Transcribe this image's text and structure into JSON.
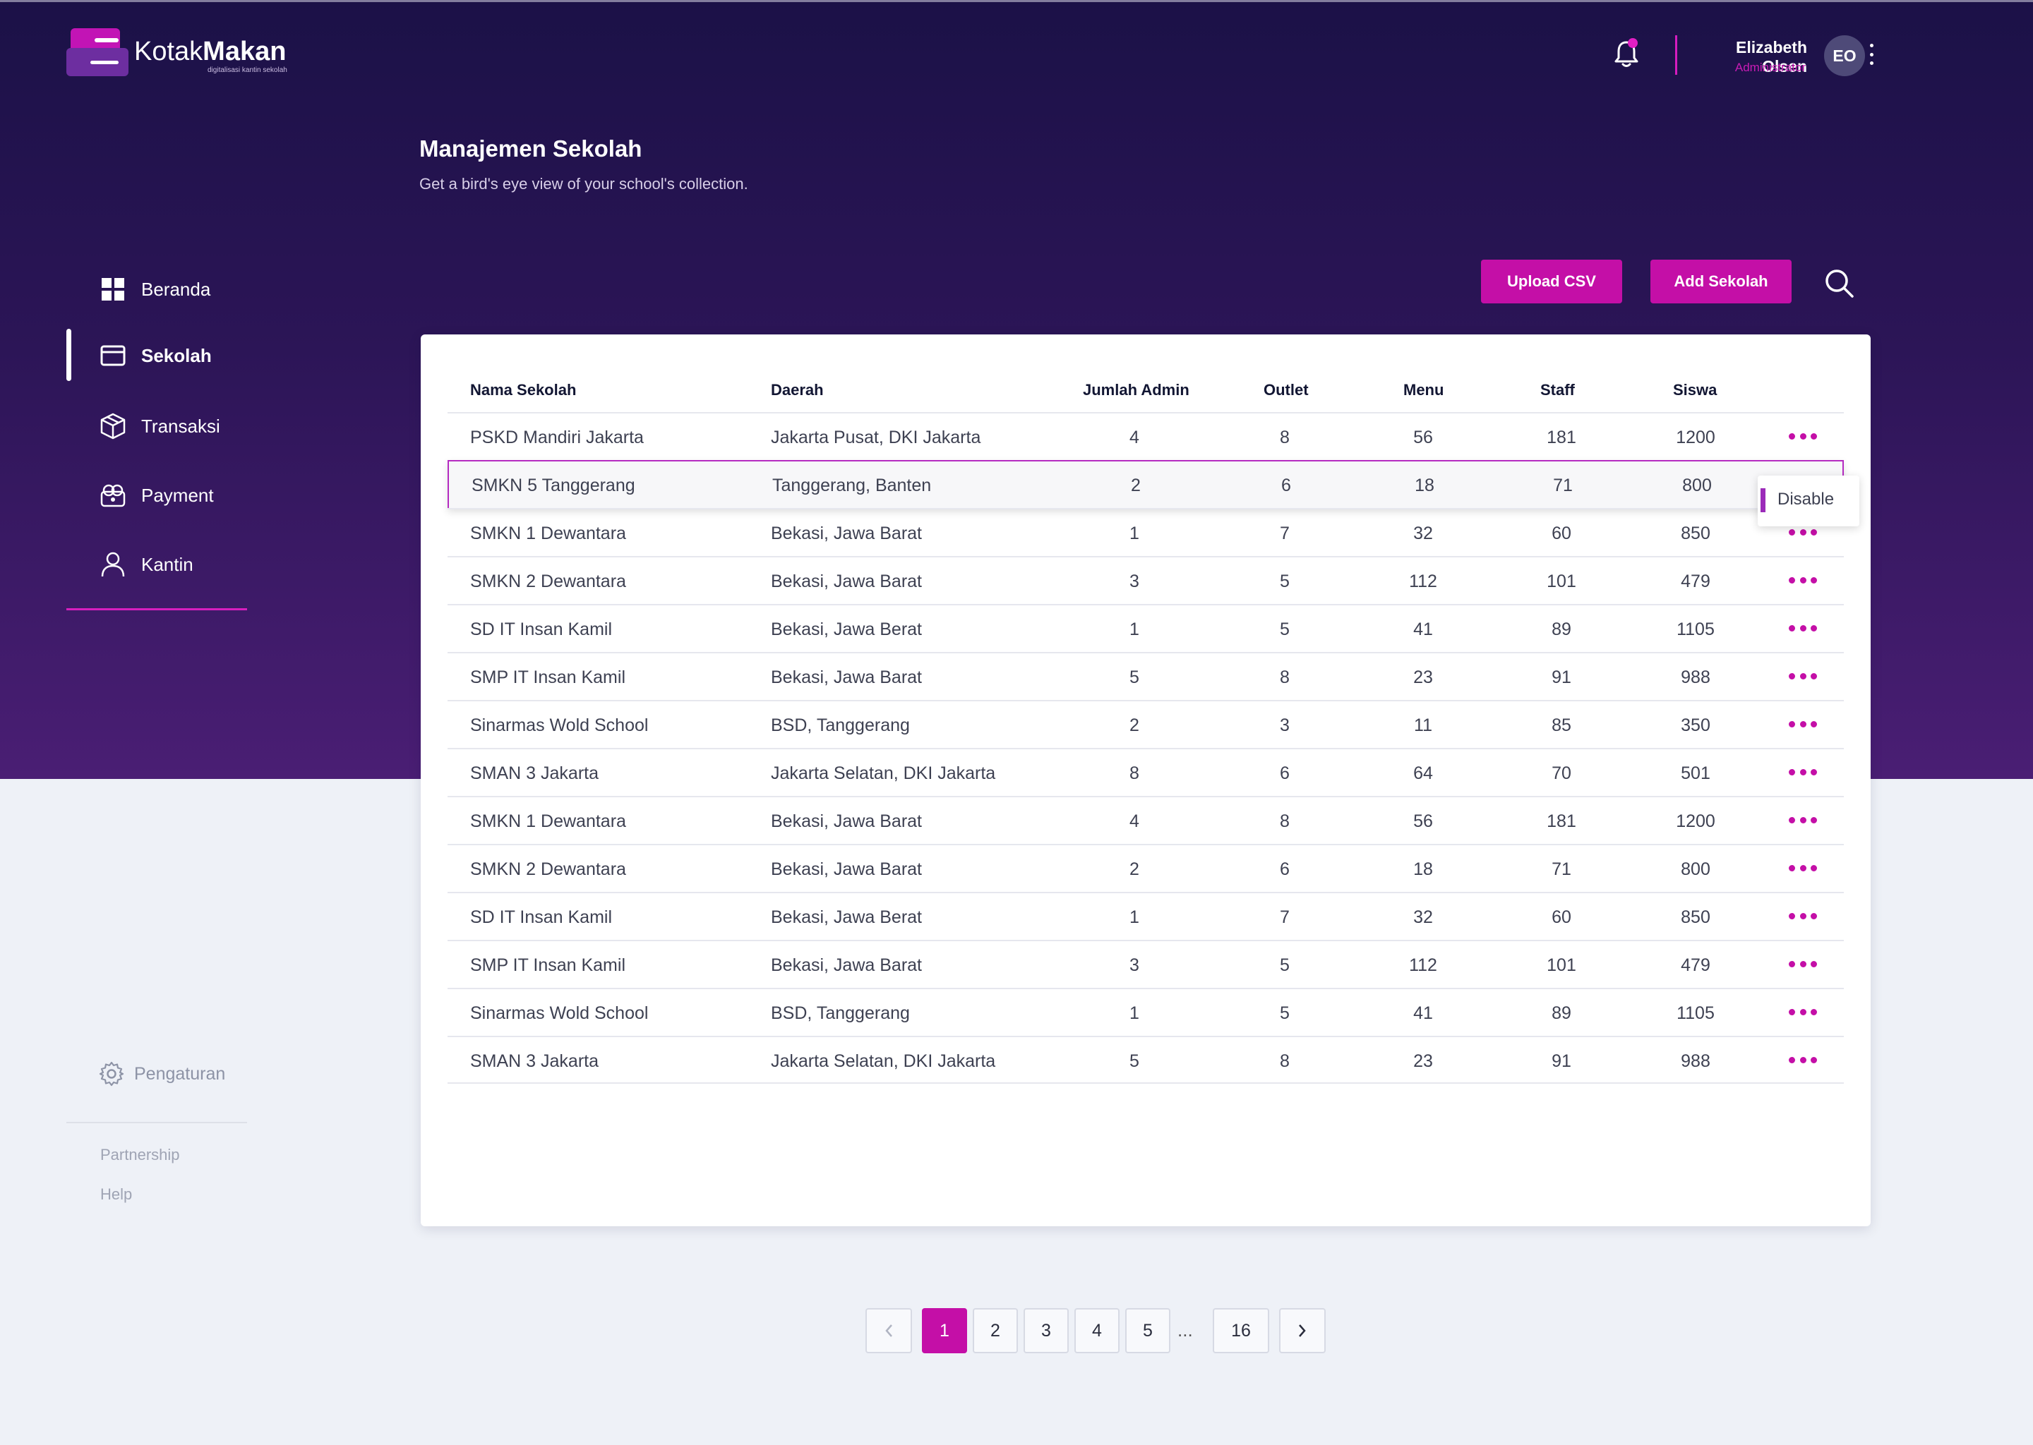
{
  "app": {
    "brand_light": "Kotak",
    "brand_bold": "Makan",
    "tagline": "digitalisasi kantin sekolah"
  },
  "header": {
    "user_name": "Elizabeth Olsen",
    "user_role": "Administrator",
    "avatar_initials": "EO"
  },
  "page": {
    "title": "Manajemen Sekolah",
    "subtitle": "Get a bird's eye view of your school's collection."
  },
  "sidebar": {
    "items": [
      {
        "label": "Beranda",
        "icon": "grid-icon",
        "active": false
      },
      {
        "label": "Sekolah",
        "icon": "card-icon",
        "active": true
      },
      {
        "label": "Transaksi",
        "icon": "box-icon",
        "active": false
      },
      {
        "label": "Payment",
        "icon": "wallet-icon",
        "active": false
      },
      {
        "label": "Kantin",
        "icon": "user-icon",
        "active": false
      }
    ],
    "settings_label": "Pengaturan",
    "links": [
      "Partnership",
      "Help"
    ]
  },
  "actions": {
    "upload_label": "Upload CSV",
    "add_label": "Add Sekolah"
  },
  "table": {
    "columns": [
      "Nama Sekolah",
      "Daerah",
      "Jumlah Admin",
      "Outlet",
      "Menu",
      "Staff",
      "Siswa"
    ],
    "rows": [
      [
        "PSKD Mandiri Jakarta",
        "Jakarta Pusat, DKI Jakarta",
        "4",
        "8",
        "56",
        "181",
        "1200"
      ],
      [
        "SMKN 5 Tanggerang",
        "Tanggerang, Banten",
        "2",
        "6",
        "18",
        "71",
        "800"
      ],
      [
        "SMKN 1 Dewantara",
        "Bekasi, Jawa Barat",
        "1",
        "7",
        "32",
        "60",
        "850"
      ],
      [
        "SMKN 2 Dewantara",
        "Bekasi, Jawa Barat",
        "3",
        "5",
        "112",
        "101",
        "479"
      ],
      [
        "SD IT Insan Kamil",
        "Bekasi, Jawa Berat",
        "1",
        "5",
        "41",
        "89",
        "1105"
      ],
      [
        "SMP IT Insan Kamil",
        "Bekasi, Jawa Barat",
        "5",
        "8",
        "23",
        "91",
        "988"
      ],
      [
        "Sinarmas Wold School",
        "BSD, Tanggerang",
        "2",
        "3",
        "11",
        "85",
        "350"
      ],
      [
        "SMAN 3 Jakarta",
        "Jakarta Selatan, DKI Jakarta",
        "8",
        "6",
        "64",
        "70",
        "501"
      ],
      [
        "SMKN 1 Dewantara",
        "Bekasi, Jawa Barat",
        "4",
        "8",
        "56",
        "181",
        "1200"
      ],
      [
        "SMKN 2 Dewantara",
        "Bekasi, Jawa Barat",
        "2",
        "6",
        "18",
        "71",
        "800"
      ],
      [
        "SD IT Insan Kamil",
        "Bekasi, Jawa Berat",
        "1",
        "7",
        "32",
        "60",
        "850"
      ],
      [
        "SMP IT Insan Kamil",
        "Bekasi, Jawa Barat",
        "3",
        "5",
        "112",
        "101",
        "479"
      ],
      [
        "Sinarmas Wold School",
        "BSD, Tanggerang",
        "1",
        "5",
        "41",
        "89",
        "1105"
      ],
      [
        "SMAN 3 Jakarta",
        "Jakarta Selatan, DKI Jakarta",
        "5",
        "8",
        "23",
        "91",
        "988"
      ]
    ],
    "selected_row": 1,
    "row_menu_option": "Disable"
  },
  "pagination": {
    "pages": [
      "1",
      "2",
      "3",
      "4",
      "5"
    ],
    "ellipsis": "...",
    "last": "16",
    "current": "1"
  },
  "colors": {
    "accent": "#c40fa7",
    "hero_top": "#1b1147",
    "hero_bottom": "#4a1e74"
  }
}
